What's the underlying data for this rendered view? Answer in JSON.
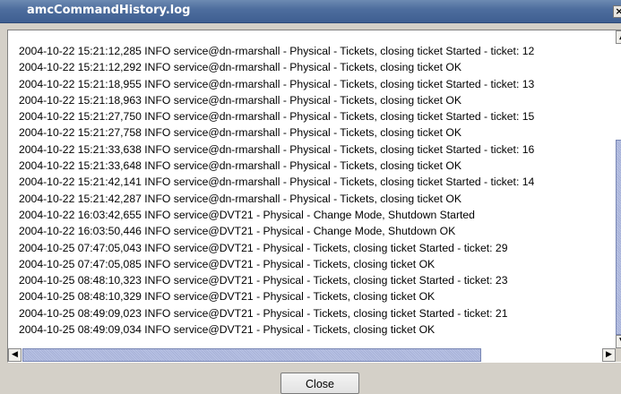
{
  "window": {
    "title": "amcCommandHistory.log",
    "close_glyph": "×"
  },
  "log": {
    "lines": [
      "2004-10-22 15:21:12,285  INFO service@dn-rmarshall - Physical - Tickets, closing ticket Started - ticket: 12",
      "2004-10-22 15:21:12,292  INFO service@dn-rmarshall - Physical - Tickets, closing ticket OK",
      "2004-10-22 15:21:18,955  INFO service@dn-rmarshall - Physical - Tickets, closing ticket Started - ticket: 13",
      "2004-10-22 15:21:18,963  INFO service@dn-rmarshall - Physical - Tickets, closing ticket OK",
      "2004-10-22 15:21:27,750  INFO service@dn-rmarshall - Physical - Tickets, closing ticket Started - ticket: 15",
      "2004-10-22 15:21:27,758  INFO service@dn-rmarshall - Physical - Tickets, closing ticket OK",
      "2004-10-22 15:21:33,638  INFO service@dn-rmarshall - Physical - Tickets, closing ticket Started - ticket: 16",
      "2004-10-22 15:21:33,648  INFO service@dn-rmarshall - Physical - Tickets, closing ticket OK",
      "2004-10-22 15:21:42,141  INFO service@dn-rmarshall - Physical - Tickets, closing ticket Started - ticket: 14",
      "2004-10-22 15:21:42,287  INFO service@dn-rmarshall - Physical - Tickets, closing ticket OK",
      "2004-10-22 16:03:42,655  INFO service@DVT21 - Physical - Change Mode, Shutdown Started",
      "2004-10-22 16:03:50,446  INFO service@DVT21 - Physical - Change Mode, Shutdown OK",
      "2004-10-25 07:47:05,043  INFO service@DVT21 - Physical - Tickets, closing ticket Started - ticket: 29",
      "2004-10-25 07:47:05,085  INFO service@DVT21 - Physical - Tickets, closing ticket OK",
      "2004-10-25 08:48:10,323  INFO service@DVT21 - Physical - Tickets, closing ticket Started - ticket: 23",
      "2004-10-25 08:48:10,329  INFO service@DVT21 - Physical - Tickets, closing ticket OK",
      "2004-10-25 08:49:09,023  INFO service@DVT21 - Physical - Tickets, closing ticket Started - ticket: 21",
      "2004-10-25 08:49:09,034  INFO service@DVT21 - Physical - Tickets, closing ticket OK"
    ]
  },
  "scrollbars": {
    "up_glyph": "▲",
    "down_glyph": "▼",
    "left_glyph": "◀",
    "right_glyph": "▶"
  },
  "footer": {
    "close_label": "Close"
  },
  "colors": {
    "titlebar": "#4e6e9e",
    "window_bg": "#d4d0c8",
    "scroll_thumb": "#a8b4d8"
  },
  "icons": [
    "close-icon",
    "scroll-up-icon",
    "scroll-down-icon",
    "scroll-left-icon",
    "scroll-right-icon"
  ]
}
